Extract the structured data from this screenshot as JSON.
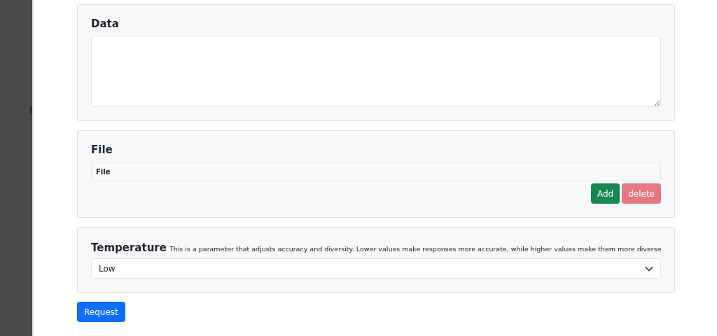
{
  "data_section": {
    "title": "Data"
  },
  "file_section": {
    "title": "File",
    "file_field": {
      "value": "File"
    },
    "buttons": [
      {
        "kind": "add",
        "label": "Add",
        "disabled": false
      },
      {
        "kind": "delete",
        "label": "delete",
        "disabled": true
      }
    ]
  },
  "temperature_section": {
    "title": "Temperature",
    "description": "This is a parameter that adjusts accuracy and diversity. Lower values make responses more accurate, while higher values make them more diverse.",
    "select": {
      "value": "Low"
    }
  },
  "submit_button": {
    "label": "Request"
  }
}
